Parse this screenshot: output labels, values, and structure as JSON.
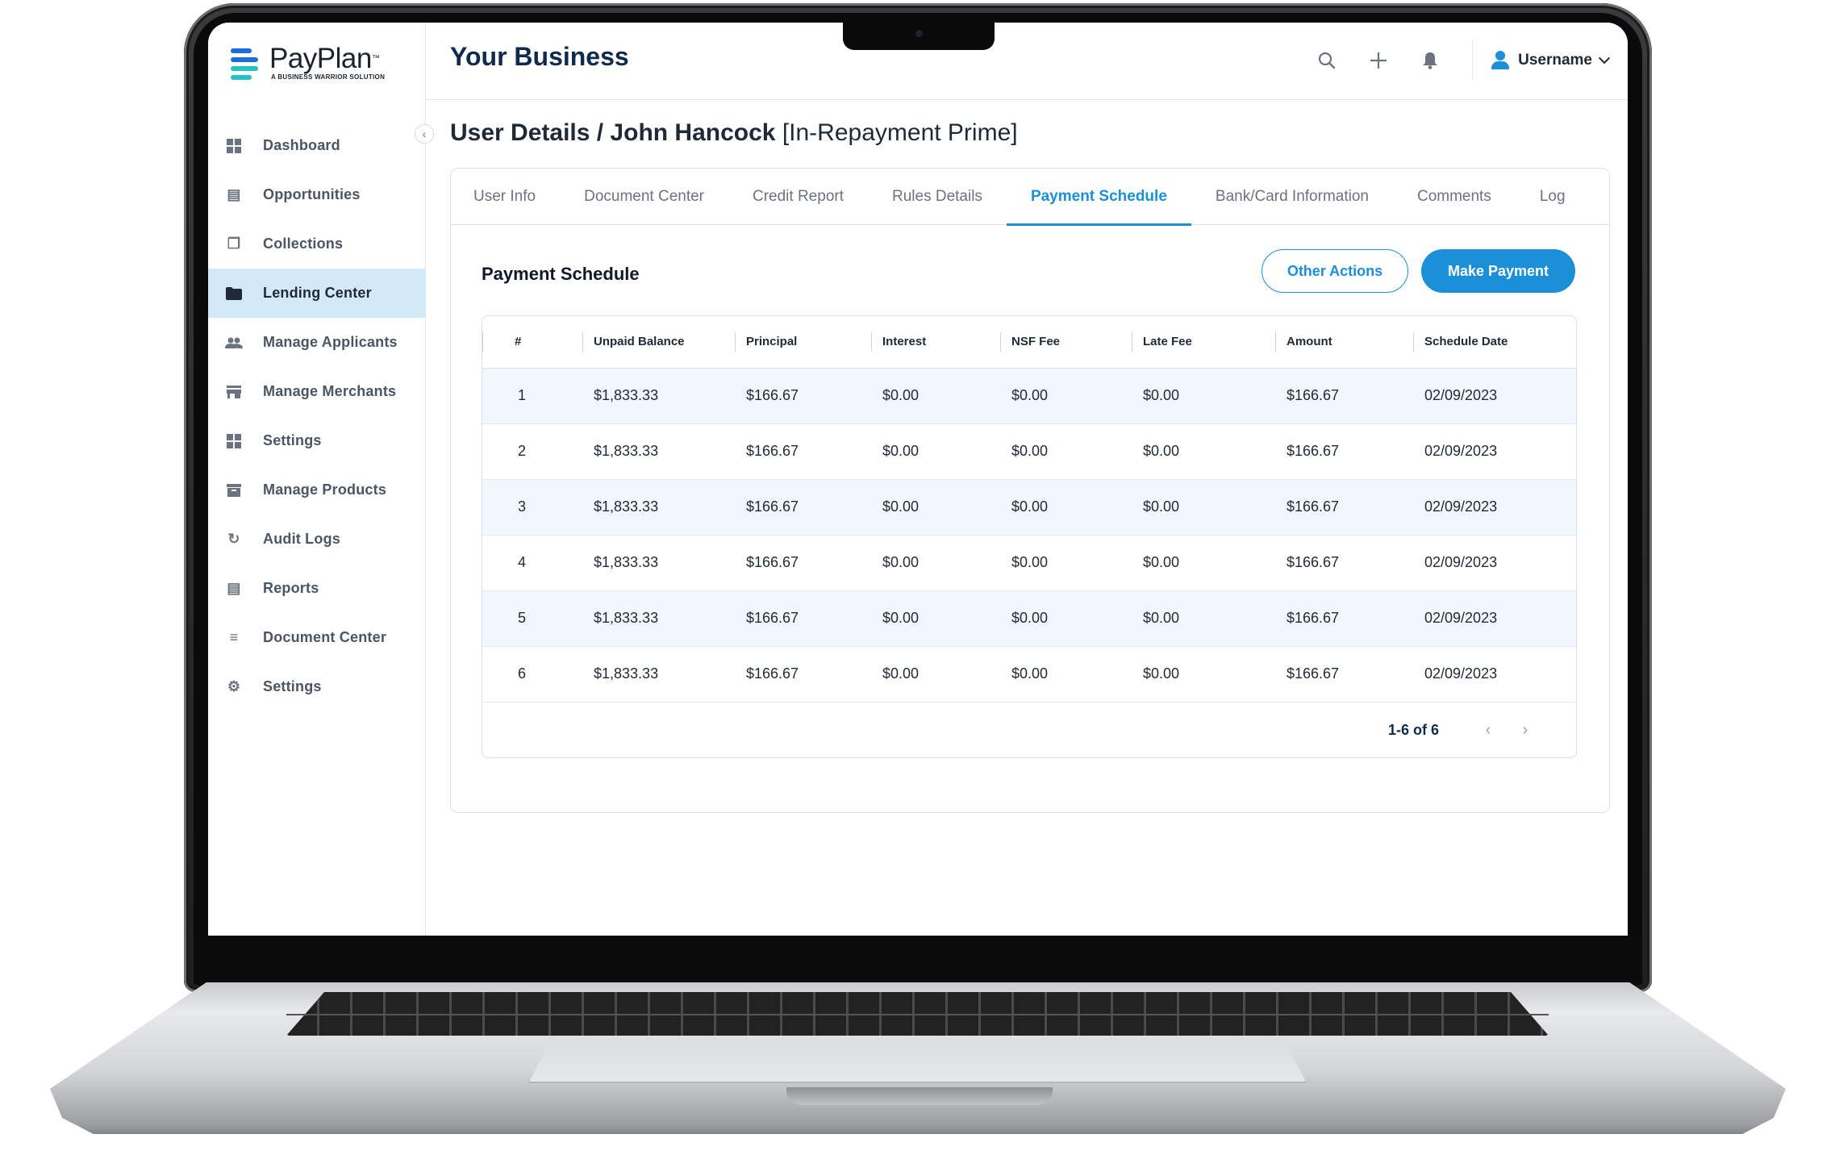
{
  "brand": {
    "name": "PayPlan",
    "trademark": "™",
    "tagline": "A BUSINESS WARRIOR SOLUTION",
    "colors": {
      "accent": "#1b8fd8",
      "logo_blue": "#1b6fd8",
      "logo_teal": "#23c4c4",
      "active_nav_bg": "#d4e9f7"
    }
  },
  "sidebar": {
    "collapse_icon": "chevron-left-icon",
    "items": [
      {
        "label": "Dashboard",
        "icon": "grid-icon",
        "active": false
      },
      {
        "label": "Opportunities",
        "icon": "document-stack-icon",
        "active": false
      },
      {
        "label": "Collections",
        "icon": "copy-icon",
        "active": false
      },
      {
        "label": "Lending Center",
        "icon": "folder-icon",
        "active": true
      },
      {
        "label": "Manage Applicants",
        "icon": "people-icon",
        "active": false
      },
      {
        "label": "Manage Merchants",
        "icon": "store-icon",
        "active": false
      },
      {
        "label": "Settings",
        "icon": "grid-icon",
        "active": false
      },
      {
        "label": "Manage Products",
        "icon": "archive-icon",
        "active": false
      },
      {
        "label": "Audit Logs",
        "icon": "history-icon",
        "active": false
      },
      {
        "label": "Reports",
        "icon": "document-stack-icon",
        "active": false
      },
      {
        "label": "Document Center",
        "icon": "list-icon",
        "active": false
      },
      {
        "label": "Settings",
        "icon": "gear-icon",
        "active": false
      }
    ]
  },
  "header": {
    "title": "Your Business",
    "icons": [
      "search-icon",
      "plus-icon",
      "bell-icon"
    ],
    "username": "Username"
  },
  "page": {
    "title_prefix": "User Details / John Hancock",
    "status_tag": "[In-Repayment Prime]"
  },
  "tabs": [
    {
      "label": "User Info",
      "active": false
    },
    {
      "label": "Document Center",
      "active": false
    },
    {
      "label": "Credit Report",
      "active": false
    },
    {
      "label": "Rules Details",
      "active": false
    },
    {
      "label": "Payment Schedule",
      "active": true
    },
    {
      "label": "Bank/Card Information",
      "active": false
    },
    {
      "label": "Comments",
      "active": false
    },
    {
      "label": "Log",
      "active": false
    }
  ],
  "schedule": {
    "title": "Payment Schedule",
    "other_actions_label": "Other Actions",
    "make_payment_label": "Make Payment",
    "columns": [
      "#",
      "Unpaid Balance",
      "Principal",
      "Interest",
      "NSF Fee",
      "Late Fee",
      "Amount",
      "Schedule Date"
    ],
    "rows": [
      [
        "1",
        "$1,833.33",
        "$166.67",
        "$0.00",
        "$0.00",
        "$0.00",
        "$166.67",
        "02/09/2023"
      ],
      [
        "2",
        "$1,833.33",
        "$166.67",
        "$0.00",
        "$0.00",
        "$0.00",
        "$166.67",
        "02/09/2023"
      ],
      [
        "3",
        "$1,833.33",
        "$166.67",
        "$0.00",
        "$0.00",
        "$0.00",
        "$166.67",
        "02/09/2023"
      ],
      [
        "4",
        "$1,833.33",
        "$166.67",
        "$0.00",
        "$0.00",
        "$0.00",
        "$166.67",
        "02/09/2023"
      ],
      [
        "5",
        "$1,833.33",
        "$166.67",
        "$0.00",
        "$0.00",
        "$0.00",
        "$166.67",
        "02/09/2023"
      ],
      [
        "6",
        "$1,833.33",
        "$166.67",
        "$0.00",
        "$0.00",
        "$0.00",
        "$166.67",
        "02/09/2023"
      ]
    ],
    "pagination": {
      "label": "1-6 of 6",
      "prev_icon": "chevron-left-icon",
      "next_icon": "chevron-right-icon"
    }
  }
}
